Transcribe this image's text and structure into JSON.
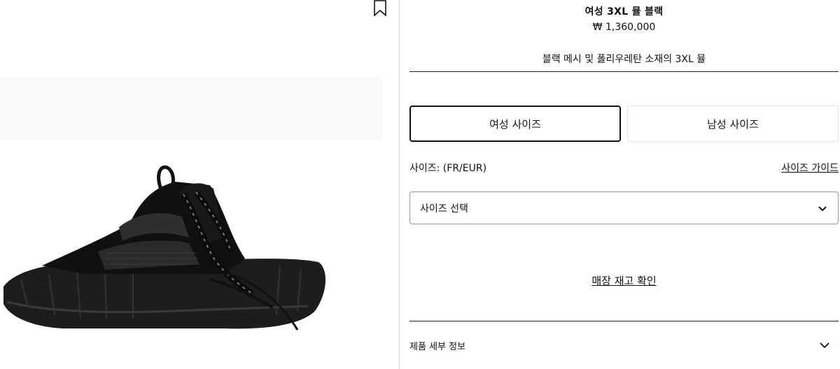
{
  "product": {
    "title": "여성 3XL 뮬 블랙",
    "price": "₩ 1,360,000",
    "description": "블랙 메시 및 폴리우레탄 소재의 3XL 뮬"
  },
  "size_tabs": {
    "women": "여성 사이즈",
    "men": "남성 사이즈",
    "selected": "women"
  },
  "size": {
    "label": "사이즈: (FR/EUR)",
    "guide_link": "사이즈 가이드",
    "select_value": "사이즈 선택"
  },
  "stock_check": "매장 재고 확인",
  "details": {
    "label": "제품 세부 정보"
  },
  "icons": {
    "bookmark": "bookmark-icon",
    "select_chevron": "chevron-down-icon",
    "details_chevron": "chevron-down-icon"
  },
  "colors": {
    "text": "#111111",
    "border_selected": "#111111",
    "border_light": "#e3e3e3",
    "shoe": "#1a1a1a"
  }
}
